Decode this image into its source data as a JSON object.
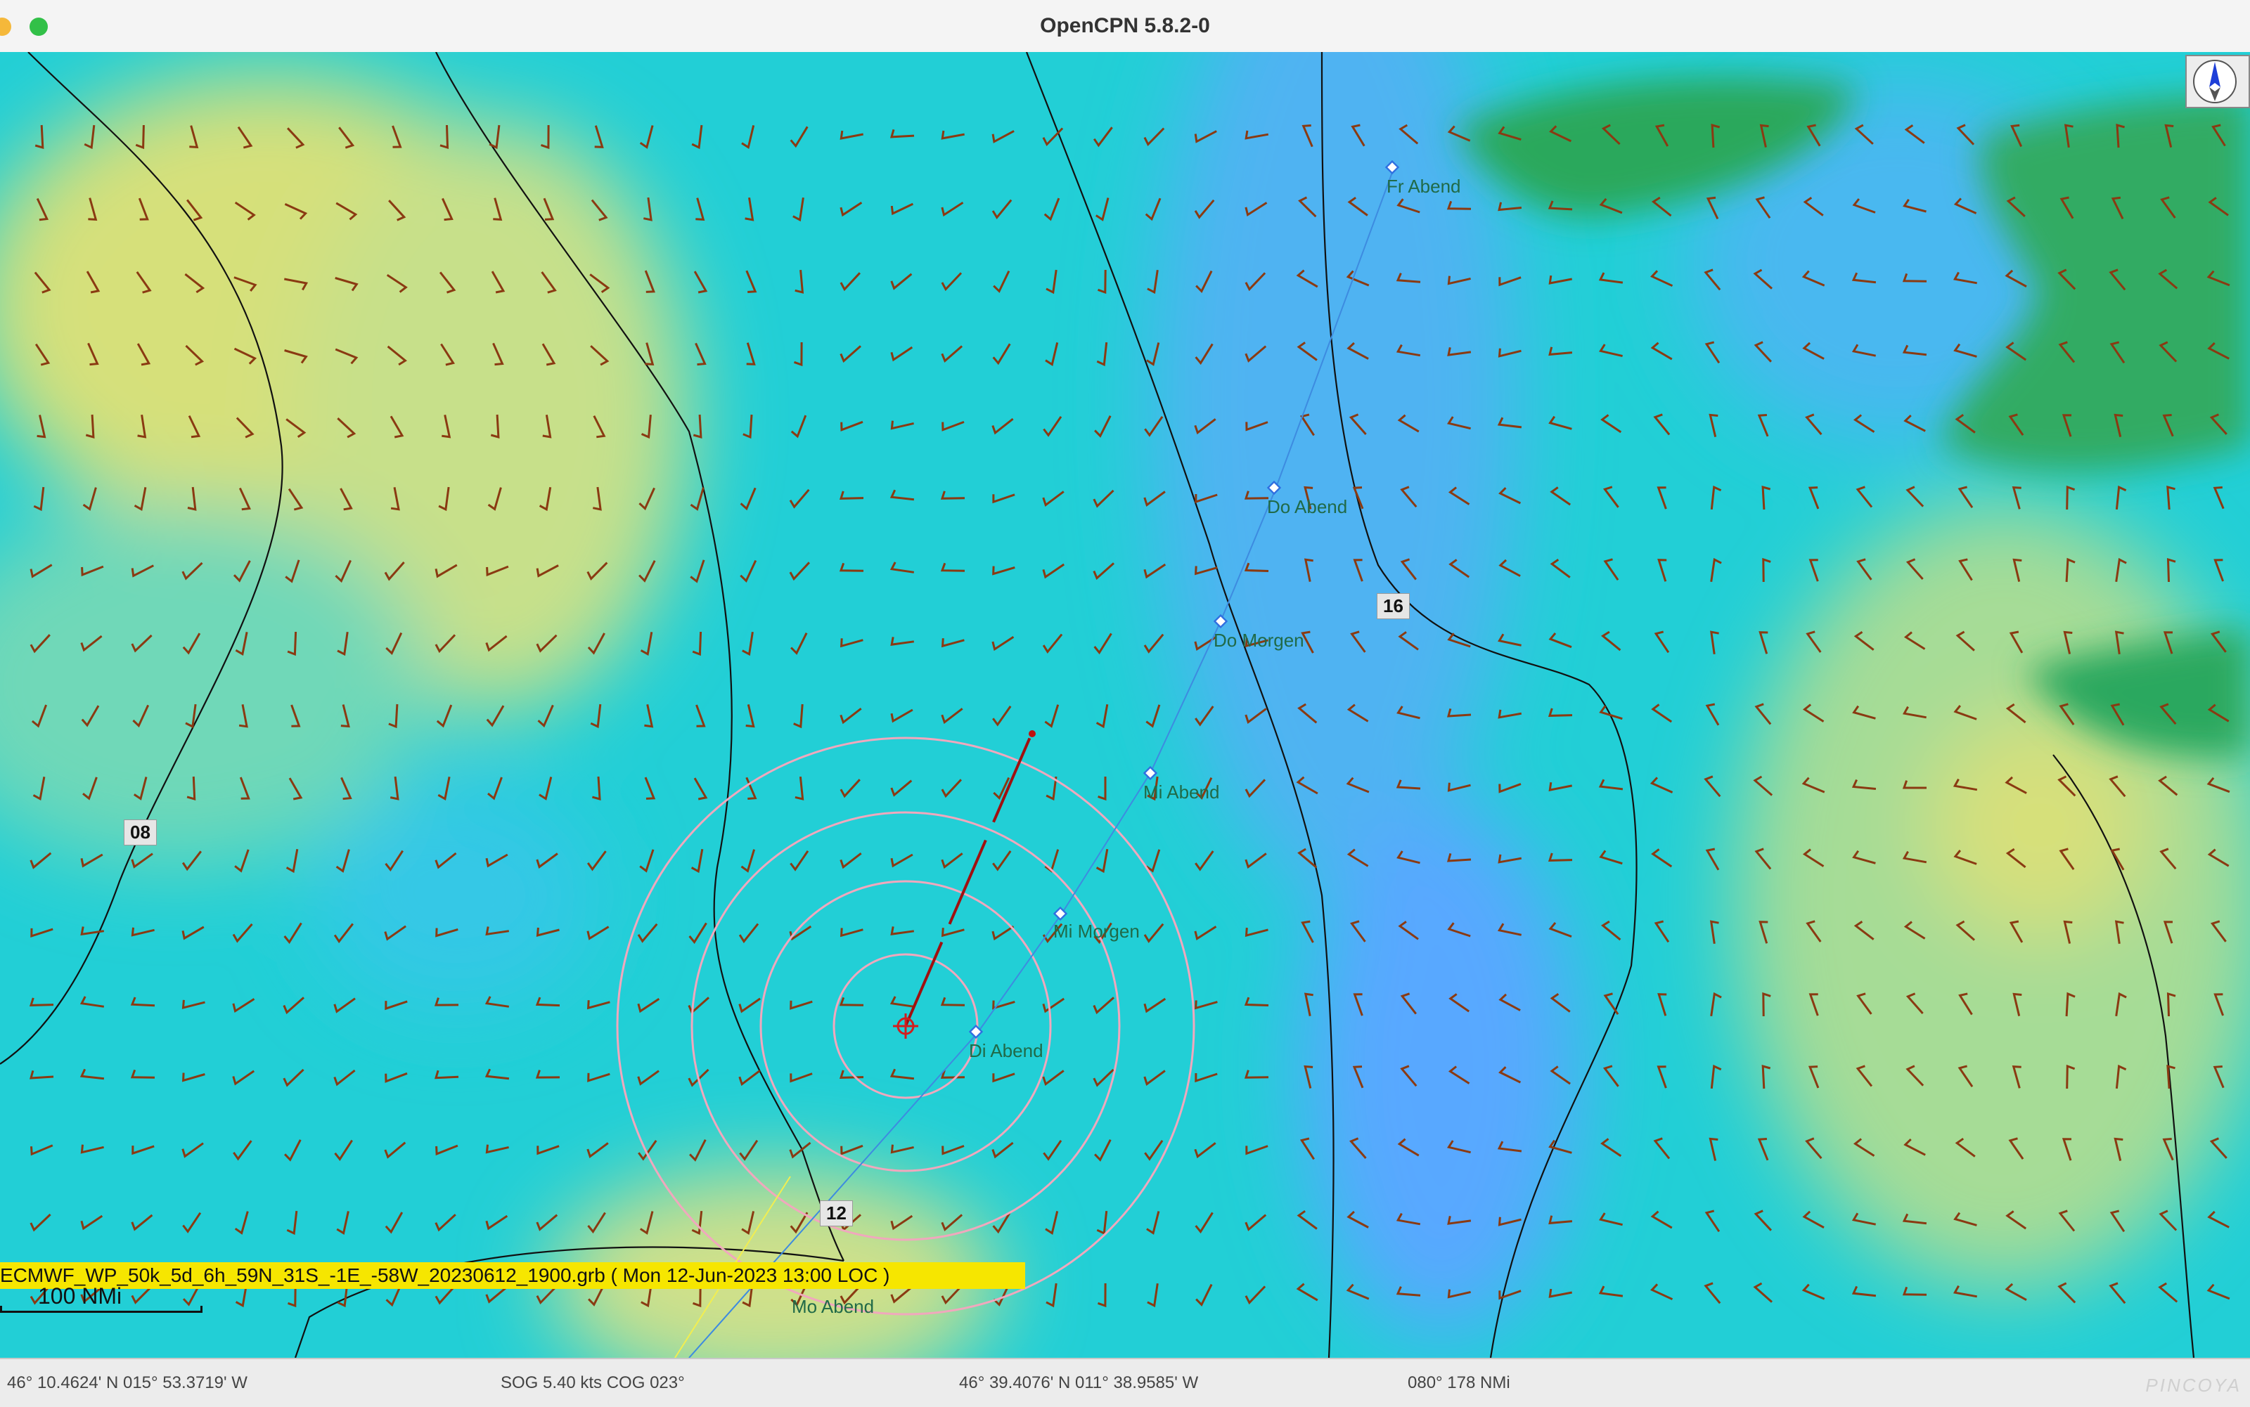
{
  "window": {
    "title": "OpenCPN 5.8.2-0"
  },
  "chart": {
    "waypoints": [
      {
        "name": "Fr Abend"
      },
      {
        "name": "Do Abend"
      },
      {
        "name": "Do Morgen"
      },
      {
        "name": "Mi Abend"
      },
      {
        "name": "Mi Morgen"
      },
      {
        "name": "Di Abend"
      },
      {
        "name": "Mo Abend"
      }
    ],
    "isobar_labels": [
      "08",
      "12",
      "16"
    ],
    "grib_file": "ECMWF_WP_50k_5d_6h_59N_31S_-1E_-58W_20230612_1900.grb ( Mon 12-Jun-2023  13:00 LOC )",
    "scale": "100 NMi",
    "compass": "north-up",
    "colors": {
      "water_low": "#1ed2d2",
      "water_deep": "#5aa8ff",
      "wind_high": "#d4df78",
      "land": "#2ea861",
      "wind_arrow": "#8a3a12",
      "route": "#3d8be0",
      "range_rings": "#f0a0b8",
      "ownship": "#d21e1e"
    }
  },
  "status": {
    "position": "46° 10.4624' N   015° 53.3719' W",
    "sog_cog": "SOG 5.40 kts  COG 023°",
    "cursor": "46° 39.4076' N   011° 38.9585' W",
    "bearing": "080°  178 NMi",
    "watermark": "PINCOYA"
  }
}
